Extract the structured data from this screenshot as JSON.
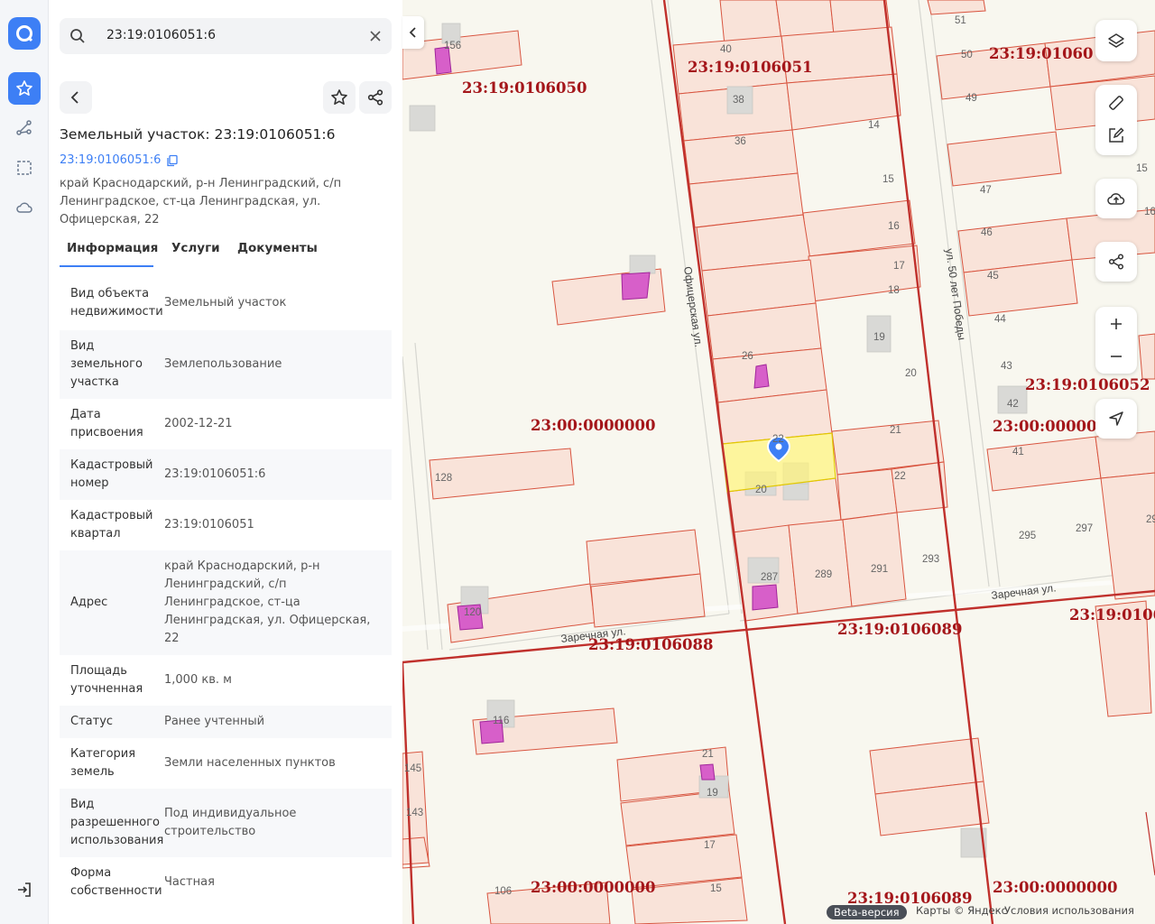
{
  "search": {
    "value": "23:19:0106051:6"
  },
  "object": {
    "title": "Земельный участок: 23:19:0106051:6",
    "cad_link": "23:19:0106051:6",
    "address": "край Краснодарский, р-н Ленинградский, с/п Ленинградское, ст-ца Ленинградская, ул. Офицерская, 22"
  },
  "tabs": [
    {
      "label": "Информация",
      "active": true
    },
    {
      "label": "Услуги",
      "active": false
    },
    {
      "label": "Документы",
      "active": false
    }
  ],
  "info_rows": [
    {
      "key": "Вид объекта недвижимости",
      "value": "Земельный участок"
    },
    {
      "key": "Вид земельного участка",
      "value": "Землепользование"
    },
    {
      "key": "Дата присвоения",
      "value": "2002-12-21"
    },
    {
      "key": "Кадастровый номер",
      "value": "23:19:0106051:6"
    },
    {
      "key": "Кадастровый квартал",
      "value": "23:19:0106051"
    },
    {
      "key": "Адрес",
      "value": "край Краснодарский, р-н Ленинградский, с/п Ленинградское, ст-ца Ленинградская, ул. Офицерская, 22"
    },
    {
      "key": "Площадь уточненная",
      "value": "1,000 кв. м"
    },
    {
      "key": "Статус",
      "value": "Ранее учтенный"
    },
    {
      "key": "Категория земель",
      "value": "Земли населенных пунктов"
    },
    {
      "key": "Вид разрешенного использования",
      "value": "Под индивидуальное строительство"
    },
    {
      "key": "Форма собственности",
      "value": "Частная"
    }
  ],
  "map": {
    "quarter_labels": [
      "23:19:0106050",
      "23:19:0106051",
      "23:19:01060",
      "23:00:0000000",
      "23:19:0106052",
      "23:00:000000",
      "23:19:0106088",
      "23:19:0106089",
      "23:19:0106",
      "23:00:0000000",
      "23:19:0106089",
      "23:00:0000000"
    ],
    "streets": [
      "Офицерская ул.",
      "ул. 50 лет Победы",
      "Заречная ул.",
      "Заречная ул."
    ],
    "numbers": [
      "156",
      "40",
      "38",
      "36",
      "14",
      "15",
      "16",
      "17",
      "18",
      "19",
      "20",
      "26",
      "22",
      "21",
      "22",
      "20",
      "287",
      "289",
      "291",
      "293",
      "128",
      "120",
      "116",
      "21",
      "19",
      "17",
      "15",
      "106",
      "145",
      "143",
      "51",
      "50",
      "49",
      "47",
      "46",
      "45",
      "44",
      "43",
      "42",
      "41",
      "295",
      "297",
      "29",
      "15",
      "16"
    ],
    "footer": {
      "beta": "Beta-версия",
      "copyright": "Карты © Яндекс",
      "terms": "Условия использования"
    }
  },
  "colors": {
    "accent": "#3d7ff5",
    "parcel_line": "#d8543f",
    "quarter_line": "#c0302c",
    "quarter_label": "#a4161a",
    "selected": "#fff47a"
  }
}
